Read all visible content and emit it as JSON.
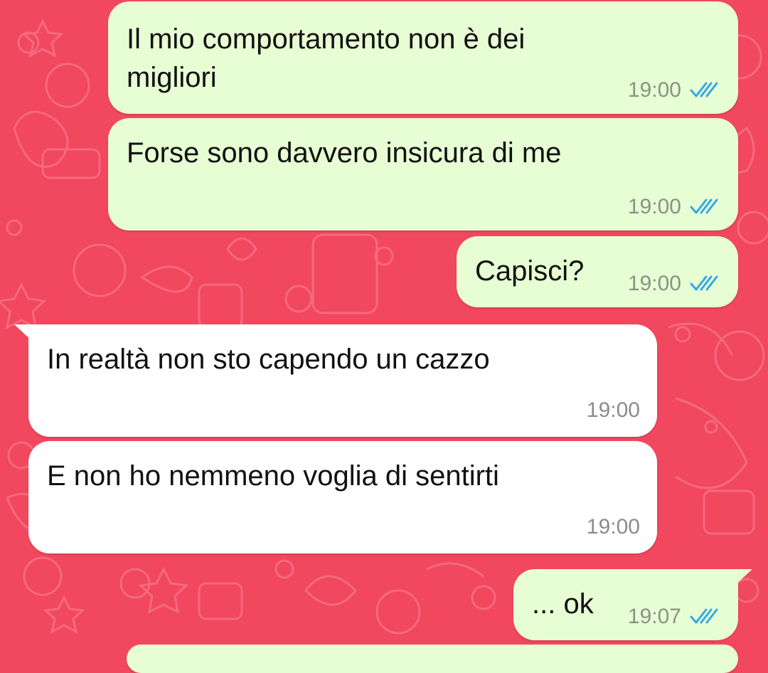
{
  "chat": {
    "messages": [
      {
        "id": "m1",
        "direction": "outgoing",
        "text": "Il mio comportamento non è dei\nmigliori",
        "time": "19:00",
        "status_icon": "double-check-read-icon"
      },
      {
        "id": "m2",
        "direction": "outgoing",
        "text": "Forse sono davvero insicura di me",
        "time": "19:00",
        "status_icon": "double-check-read-icon"
      },
      {
        "id": "m3",
        "direction": "outgoing",
        "text": "Capisci?",
        "time": "19:00",
        "status_icon": "double-check-read-icon"
      },
      {
        "id": "m4",
        "direction": "incoming",
        "text": "In realtà non sto capendo un cazzo",
        "time": "19:00"
      },
      {
        "id": "m5",
        "direction": "incoming",
        "text": "E non ho nemmeno voglia di sentirti",
        "time": "19:00"
      },
      {
        "id": "m6",
        "direction": "outgoing",
        "text": "... ok",
        "time": "19:07",
        "status_icon": "double-check-read-icon"
      }
    ]
  },
  "colors": {
    "wallpaper": "#f1475f",
    "outgoing_bubble": "#e7fdd3",
    "incoming_bubble": "#ffffff",
    "read_ticks": "#34a9e6"
  }
}
